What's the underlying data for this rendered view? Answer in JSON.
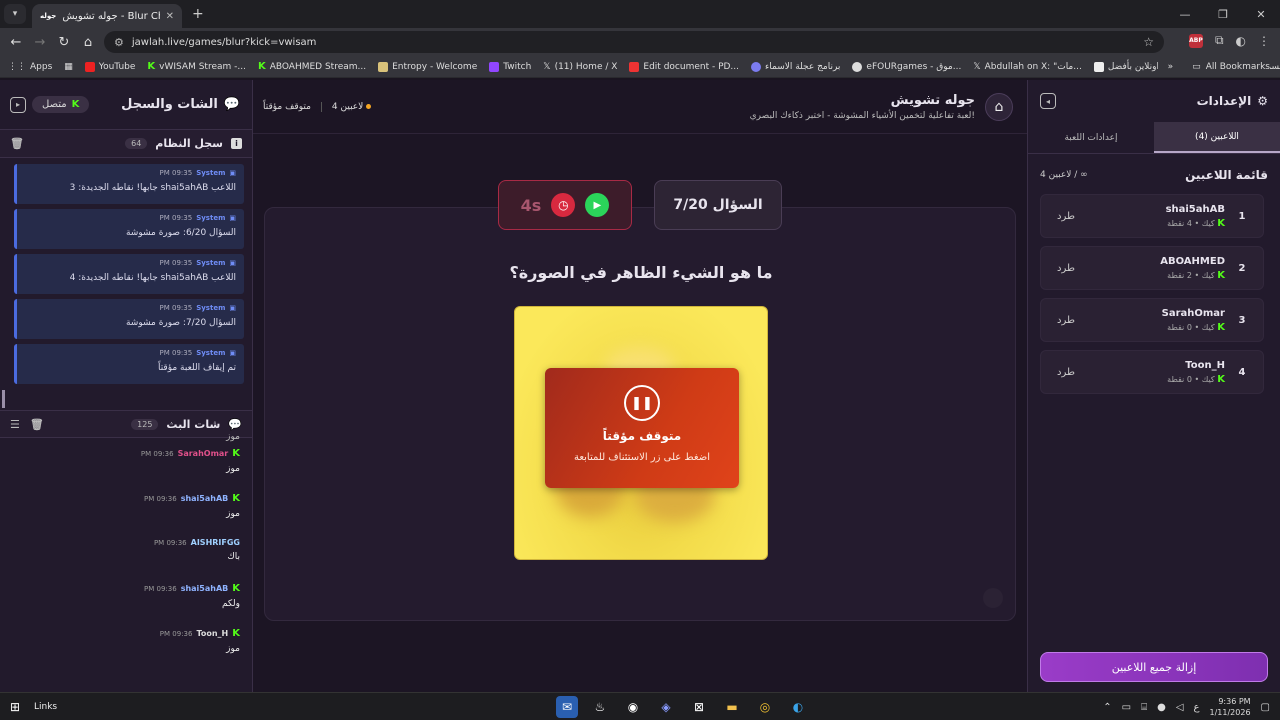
{
  "browser": {
    "tab_title": "جوله تشويش - Blur Challenge |",
    "tab_favicon": "جوله",
    "url": "jawlah.live/games/blur?kick=vwisam",
    "bookmarks": [
      "Apps",
      "YouTube",
      "vWISAM Stream -...",
      "ABOAHMED Stream...",
      "Entropy - Welcome",
      "Twitch",
      "(11) Home / X",
      "Edit document - PD...",
      "برنامج عجلة الاسماء",
      "eFOURgames - موق...",
      "Abdullah on X: \"مات...",
      "اشتري اونلاين بأفضل...",
      "مجسم عمدة الحي -...",
      "All Bookmarks"
    ],
    "ext_abp": "ABP"
  },
  "chat": {
    "title": "الشات والسجل",
    "status": "متصل",
    "kick_glyph": "K",
    "system_log": {
      "title": "سجل النظام",
      "count": "64",
      "messages": [
        {
          "who": "System",
          "time": "09:35 PM",
          "text": "اللاعب shai5ahAB جابها! نقاطه الجديدة: 3"
        },
        {
          "who": "System",
          "time": "09:35 PM",
          "text": "السؤال 6/20: صورة مشوشة"
        },
        {
          "who": "System",
          "time": "09:35 PM",
          "text": "اللاعب shai5ahAB جابها! نقاطه الجديدة: 4"
        },
        {
          "who": "System",
          "time": "09:35 PM",
          "text": "السؤال 7/20: صورة مشوشة"
        },
        {
          "who": "System",
          "time": "09:35 PM",
          "text": "تم إيقاف اللعبة مؤقتاً"
        }
      ]
    },
    "stream_chat": {
      "title": "شات البث",
      "count": "125",
      "partial_text": "موز",
      "messages": [
        {
          "user": "SarahOmar",
          "time": "09:36 PM",
          "text": "موز",
          "color": "#e0508a"
        },
        {
          "user": "shai5ahAB",
          "time": "09:36 PM",
          "text": "موز",
          "color": "#8fb3ff"
        },
        {
          "user": "AISHRIFGG",
          "time": "09:36 PM",
          "text": "باك",
          "color": "#9fd0ff"
        },
        {
          "user": "shai5ahAB",
          "time": "09:36 PM",
          "text": "ولكم",
          "color": "#8fb3ff"
        },
        {
          "user": "Toon_H",
          "time": "09:36 PM",
          "text": "موز",
          "color": "#dddddd"
        }
      ]
    }
  },
  "game": {
    "title": "جوله تشويش",
    "subtitle": "لعبة تفاعلية لتخمين الأشياء المشوشة - اختبر ذكاءك البصري!",
    "players_count": "4 لاعبين",
    "state": "متوقف مؤقتاً",
    "question_counter": "السؤال 7/20",
    "timer": "4s",
    "question": "ما هو الشيء الظاهر في الصورة؟",
    "paused_title": "متوقف مؤقتاً",
    "paused_hint": "اضغط على زر الاستئناف للمتابعة"
  },
  "settings": {
    "title": "الإعدادات",
    "tab_players": "اللاعبين (4)",
    "tab_game": "إعدادات اللعبة",
    "list_title": "قائمة اللاعبين",
    "list_count": "4 لاعبين / ∞",
    "players": [
      {
        "rank": "1",
        "name": "shai5ahAB",
        "sub": "كيك • 4 نقطة",
        "kick": "طرد"
      },
      {
        "rank": "2",
        "name": "ABOAHMED",
        "sub": "كيك • 2 نقطة",
        "kick": "طرد"
      },
      {
        "rank": "3",
        "name": "SarahOmar",
        "sub": "كيك • 0 نقطة",
        "kick": "طرد"
      },
      {
        "rank": "4",
        "name": "Toon_H",
        "sub": "كيك • 0 نقطة",
        "kick": "طرد"
      }
    ],
    "remove_all": "إزالة جميع اللاعبين"
  },
  "taskbar": {
    "links": "Links",
    "time": "9:36 PM",
    "date": "1/11/2026",
    "lang": "ع"
  },
  "colors": {
    "accent_kick": "#53fc18",
    "danger": "#d8293f",
    "success": "#2bd45a",
    "purple": "#9a3cc8"
  }
}
